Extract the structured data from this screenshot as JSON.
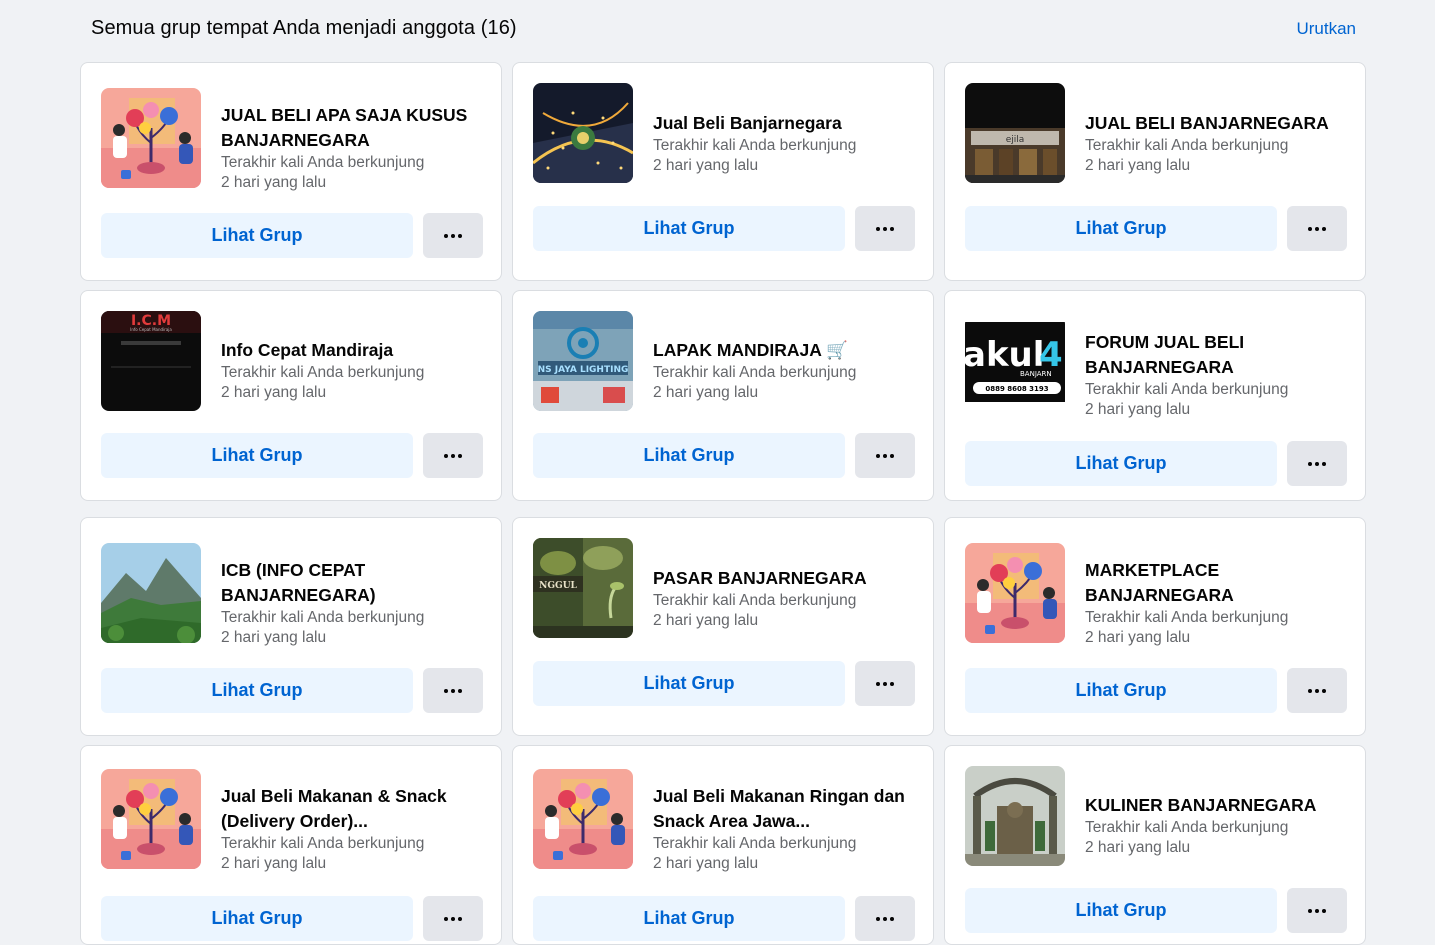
{
  "header": {
    "title": "Semua grup tempat Anda menjadi anggota (16)",
    "sort_label": "Urutkan"
  },
  "groups": [
    {
      "name": "JUAL BELI APA SAJA KUSUS BANJARNEGARA",
      "visit_label": "Terakhir kali Anda berkunjung",
      "visit_time": "2 hari yang lalu",
      "view_label": "Lihat Grup",
      "thumb": "illustration-plant"
    },
    {
      "name": "Jual Beli Banjarnegara",
      "visit_label": "Terakhir kali Anda berkunjung",
      "visit_time": "2 hari yang lalu",
      "view_label": "Lihat Grup",
      "thumb": "night-city"
    },
    {
      "name": "JUAL BELI BANJARNEGARA",
      "visit_label": "Terakhir kali Anda berkunjung",
      "visit_time": "2 hari yang lalu",
      "view_label": "Lihat Grup",
      "thumb": "storefront"
    },
    {
      "name": "Info Cepat Mandiraja",
      "visit_label": "Terakhir kali Anda berkunjung",
      "visit_time": "2 hari yang lalu",
      "view_label": "Lihat Grup",
      "thumb": "icm-dark"
    },
    {
      "name": "LAPAK MANDIRAJA 🛒",
      "visit_label": "Terakhir kali Anda berkunjung",
      "visit_time": "2 hari yang lalu",
      "view_label": "Lihat Grup",
      "thumb": "lighting-shop"
    },
    {
      "name": "FORUM JUAL BELI BANJARNEGARA",
      "visit_label": "Terakhir kali Anda berkunjung",
      "visit_time": "2 hari yang lalu",
      "view_label": "Lihat Grup",
      "thumb": "akul-ad"
    },
    {
      "name": "ICB (INFO CEPAT BANJARNEGARA)",
      "visit_label": "Terakhir kali Anda berkunjung",
      "visit_time": "2 hari yang lalu",
      "view_label": "Lihat Grup",
      "thumb": "mountain"
    },
    {
      "name": "PASAR BANJARNEGARA",
      "visit_label": "Terakhir kali Anda berkunjung",
      "visit_time": "2 hari yang lalu",
      "view_label": "Lihat Grup",
      "thumb": "seedling"
    },
    {
      "name": "MARKETPLACE BANJARNEGARA",
      "visit_label": "Terakhir kali Anda berkunjung",
      "visit_time": "2 hari yang lalu",
      "view_label": "Lihat Grup",
      "thumb": "illustration-plant"
    },
    {
      "name": "Jual Beli Makanan & Snack (Delivery Order)...",
      "visit_label": "Terakhir kali Anda berkunjung",
      "visit_time": "2 hari yang lalu",
      "view_label": "Lihat Grup",
      "thumb": "illustration-plant"
    },
    {
      "name": "Jual Beli Makanan Ringan dan Snack Area Jawa...",
      "visit_label": "Terakhir kali Anda berkunjung",
      "visit_time": "2 hari yang lalu",
      "view_label": "Lihat Grup",
      "thumb": "illustration-plant"
    },
    {
      "name": "KULINER BANJARNEGARA",
      "visit_label": "Terakhir kali Anda berkunjung",
      "visit_time": "2 hari yang lalu",
      "view_label": "Lihat Grup",
      "thumb": "monument"
    }
  ]
}
